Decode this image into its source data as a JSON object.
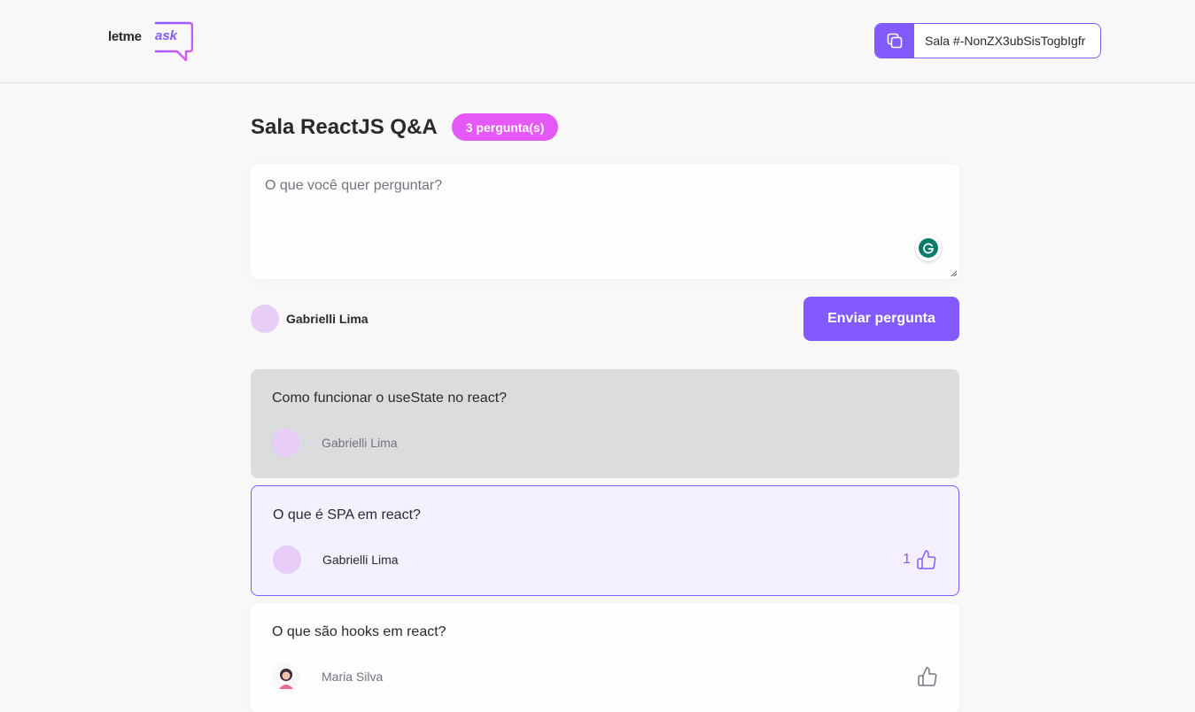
{
  "header": {
    "logo": {
      "part1": "letme",
      "part2": "ask"
    },
    "room_code": {
      "label": "Sala #-NonZX3ubSisTogbIgfr",
      "icon": "copy-icon"
    }
  },
  "main": {
    "title": "Sala ReactJS Q&A",
    "badge": "3 pergunta(s)",
    "ask_form": {
      "placeholder": "O que você quer perguntar?",
      "value": "",
      "user_name": "Gabrielli Lima",
      "submit_label": "Enviar pergunta"
    },
    "questions": [
      {
        "content": "Como funcionar o useState no react?",
        "author": "Gabrielli Lima",
        "state": "answered"
      },
      {
        "content": "O que é SPA em react?",
        "author": "Gabrielli Lima",
        "likes": "1",
        "state": "highlighted"
      },
      {
        "content": "O que são hooks em react?",
        "author": "Maria Silva",
        "state": "default"
      }
    ]
  },
  "colors": {
    "primary": "#835afd",
    "badge": "#e559f9",
    "background": "#f8f8f8",
    "answered_bg": "#dbdcdd",
    "highlighted_bg": "#f4f0ff",
    "avatar_placeholder": "#e8cdf6"
  }
}
